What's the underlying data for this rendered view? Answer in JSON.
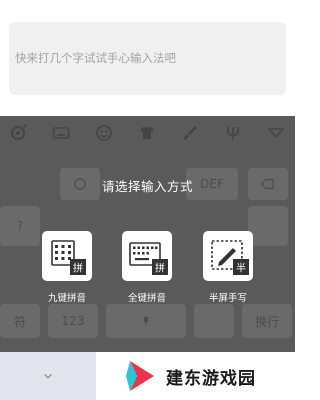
{
  "input": {
    "placeholder": "快来打几个字试试手心输入法吧"
  },
  "toolbar": {
    "icons": [
      "gear-icon",
      "keyboard-icon",
      "emoji-icon",
      "tshirt-icon",
      "brush-icon",
      "pitchfork-icon",
      "collapse-icon"
    ]
  },
  "overlay": {
    "title": "请选择输入方式",
    "modes": [
      {
        "label": "九键拼音",
        "badge": "拼"
      },
      {
        "label": "全键拼音",
        "badge": "拼"
      },
      {
        "label": "半屏手写",
        "badge": "半"
      }
    ]
  },
  "background_keys": {
    "def": "DEF",
    "q": "?",
    "num": "123",
    "fu": "符",
    "enter": "换行"
  },
  "watermark": {
    "text": "建东游戏园"
  },
  "colors": {
    "keyboard_bg": "#5a5a5a",
    "accent_red": "#e8344e",
    "accent_cyan": "#2ec4d6"
  }
}
